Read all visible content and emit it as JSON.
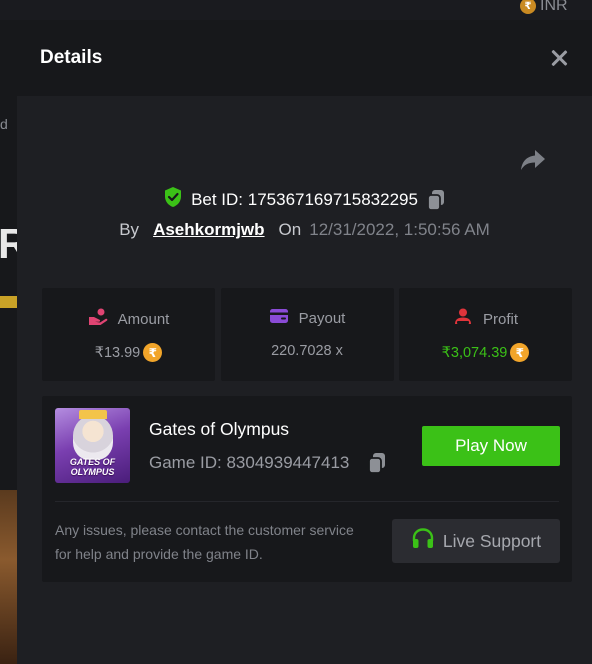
{
  "background": {
    "currency_label": "INR",
    "currency_symbol": "₹"
  },
  "modal": {
    "title": "Details",
    "bet_id_prefix": "Bet ID: ",
    "bet_id": "175367169715832295",
    "by_label": "By",
    "username": "Asehkormjwb",
    "on_label": "On",
    "datetime": "12/31/2022, 1:50:56 AM"
  },
  "stats": {
    "amount": {
      "label": "Amount",
      "value": "₹13.99"
    },
    "payout": {
      "label": "Payout",
      "value": "220.7028 x"
    },
    "profit": {
      "label": "Profit",
      "value": "₹3,074.39"
    },
    "coin_symbol": "₹"
  },
  "game": {
    "name": "Gates of Olympus",
    "id_label": "Game ID: 8304939447413",
    "thumb_line1": "GATES OF",
    "thumb_line2": "OLYMPUS",
    "play_label": "Play Now",
    "issue_text": "Any issues, please contact the customer service for help and provide the game ID.",
    "support_label": "Live Support"
  },
  "colors": {
    "accent_green": "#3bc117",
    "shield_green": "#3bc117",
    "amount_icon": "#e04473",
    "payout_icon": "#8a4bd6",
    "profit_icon": "#e0343b",
    "coin": "#f2a52a"
  },
  "icons": {
    "close": "close-icon",
    "share": "share-icon",
    "shield": "shield-check-icon",
    "copy": "copy-icon",
    "amount": "hand-coins-icon",
    "payout": "wallet-icon",
    "profit": "user-money-icon",
    "support": "headset-icon"
  }
}
